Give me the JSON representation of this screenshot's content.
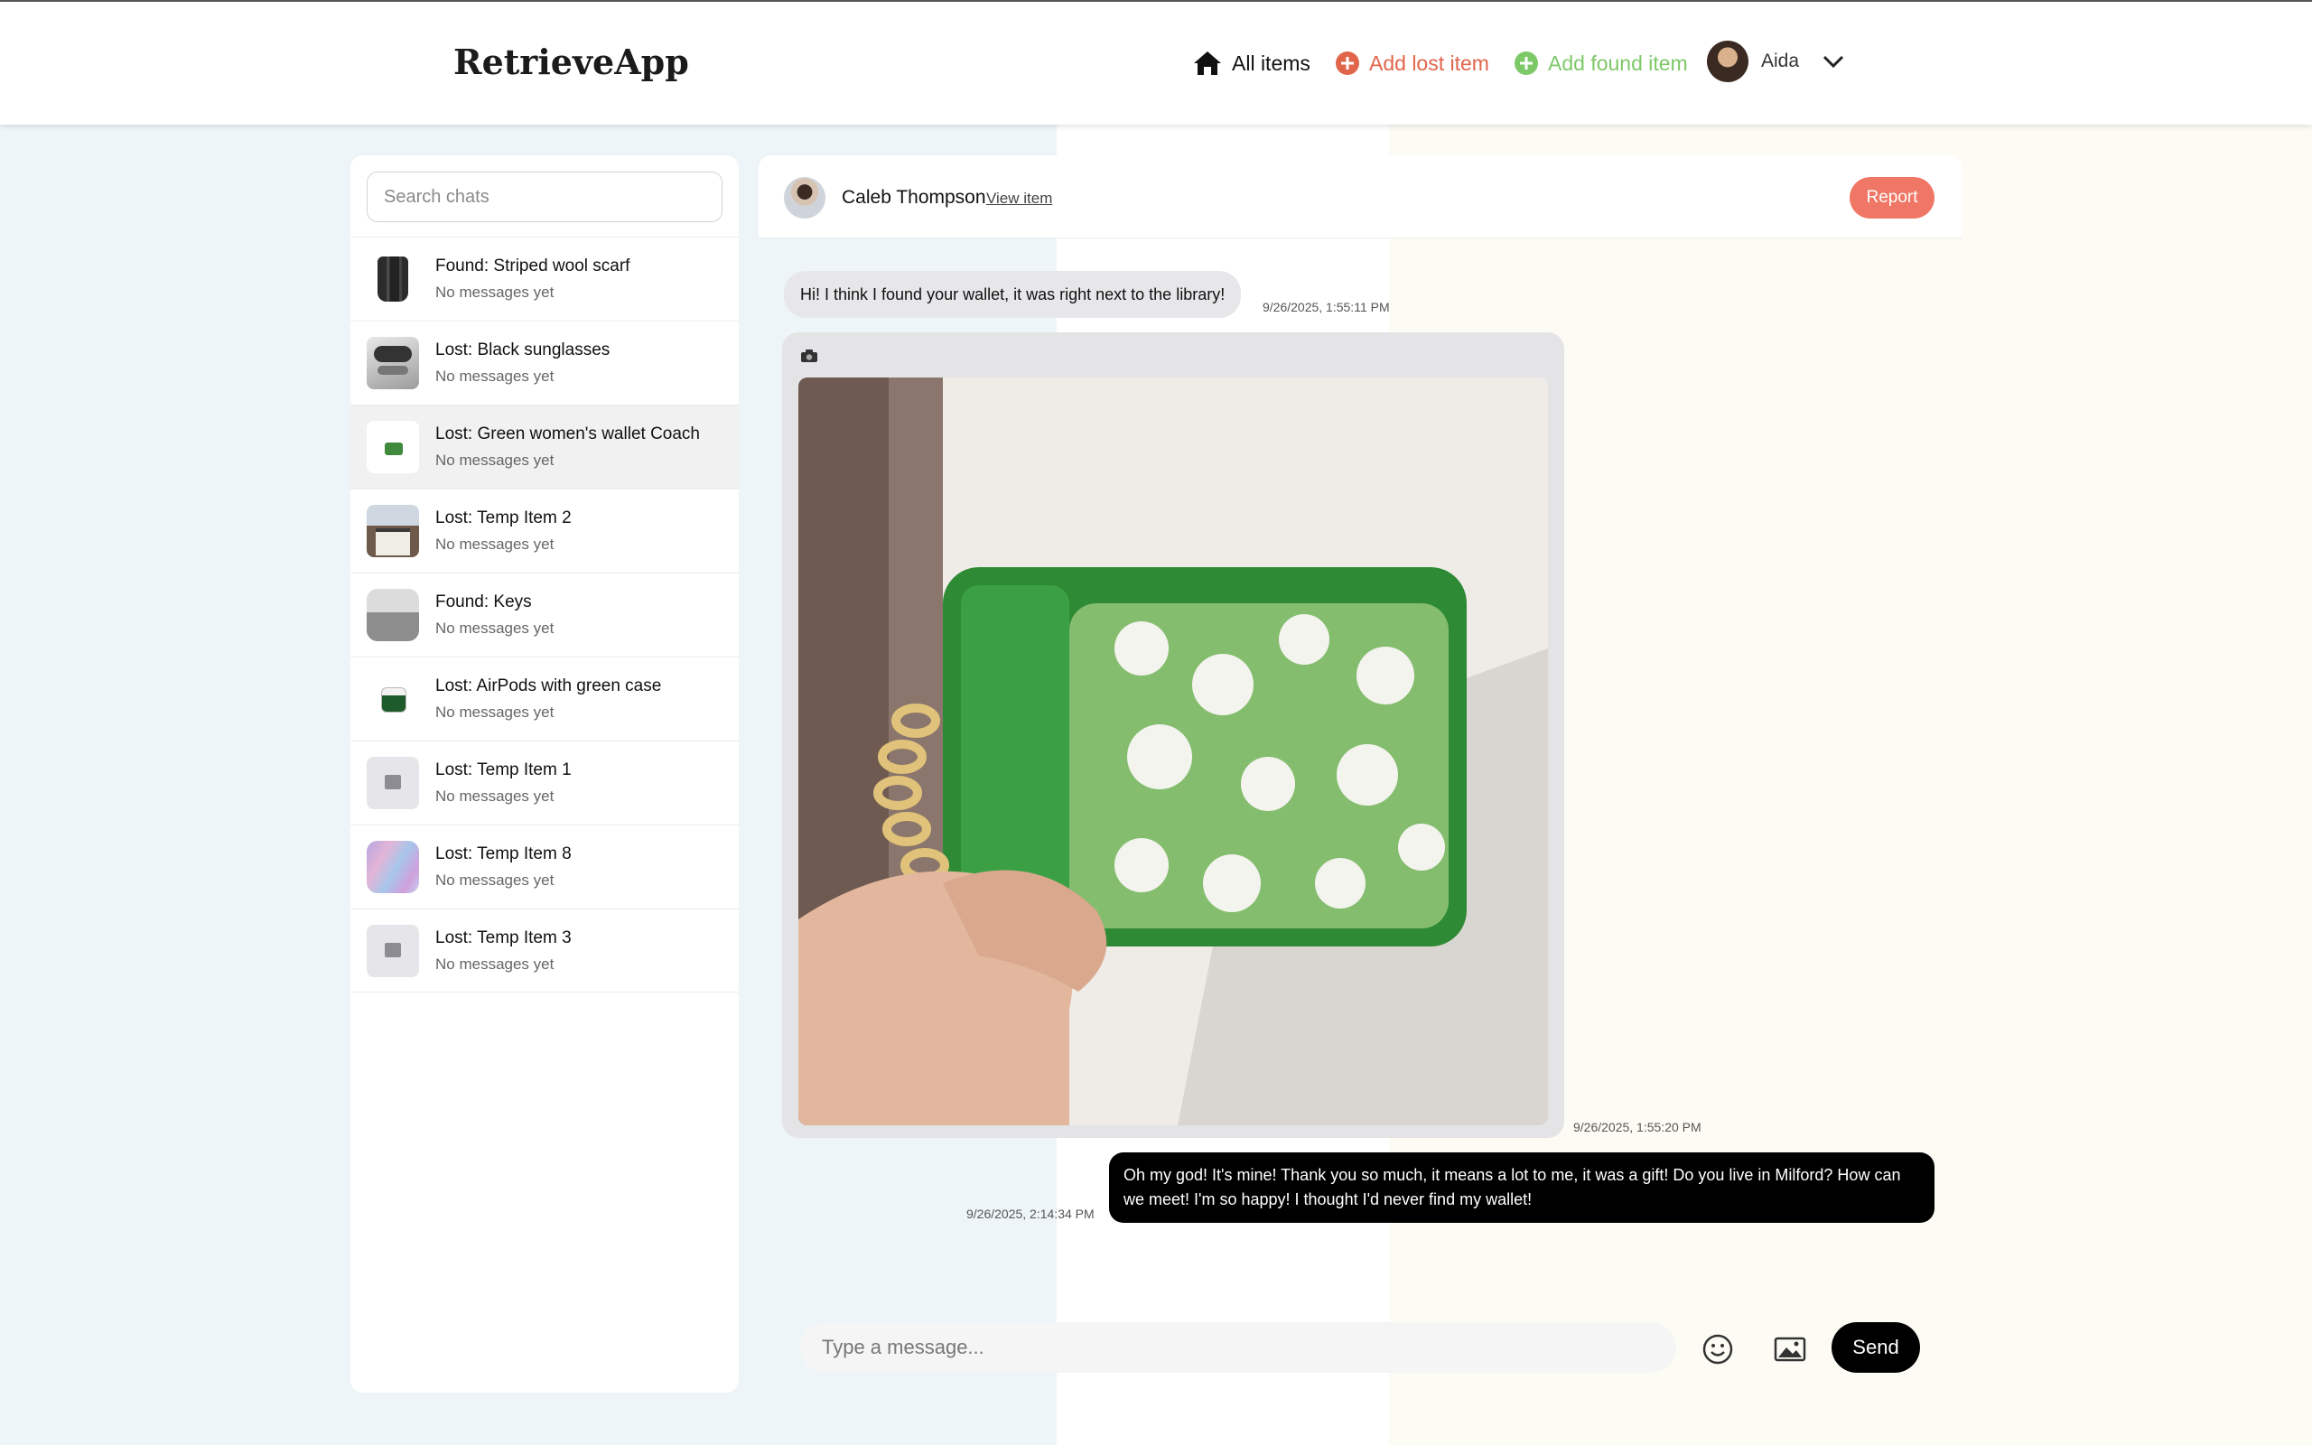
{
  "app": {
    "brand": "RetrieveApp"
  },
  "nav": {
    "all_items": "All items",
    "add_lost": "Add lost item",
    "add_found": "Add found item",
    "user_name": "Aida"
  },
  "sidebar": {
    "search_placeholder": "Search chats",
    "items": [
      {
        "title": "Found: Striped wool scarf",
        "subtitle": "No messages yet",
        "thumb": "scarf"
      },
      {
        "title": "Lost: Black sunglasses",
        "subtitle": "No messages yet",
        "thumb": "sunglasses"
      },
      {
        "title": "Lost: Green women's wallet Coach",
        "subtitle": "No messages yet",
        "thumb": "wallet",
        "active": true
      },
      {
        "title": "Lost: Temp Item 2",
        "subtitle": "No messages yet",
        "thumb": "house"
      },
      {
        "title": "Found: Keys",
        "subtitle": "No messages yet",
        "thumb": "keys"
      },
      {
        "title": "Lost: AirPods with green case",
        "subtitle": "No messages yet",
        "thumb": "airpods"
      },
      {
        "title": "Lost: Temp Item 1",
        "subtitle": "No messages yet",
        "thumb": "placeholder"
      },
      {
        "title": "Lost: Temp Item 8",
        "subtitle": "No messages yet",
        "thumb": "marble"
      },
      {
        "title": "Lost: Temp Item 3",
        "subtitle": "No messages yet",
        "thumb": "placeholder"
      }
    ]
  },
  "chat": {
    "contact_name": "Caleb Thompson",
    "view_item": "View item",
    "report": "Report",
    "messages": [
      {
        "text": "Hi! I think I found your wallet, it was right next to the library!",
        "time": "9/26/2025, 1:55:11 PM"
      },
      {
        "image": "green-wallet-photo",
        "time": "9/26/2025, 1:55:20 PM"
      },
      {
        "text": "Oh my god! It's mine! Thank you so much, it means a lot to me, it was a gift! Do you live in Milford? How can we meet! I'm so happy! I thought I'd never find my wallet!",
        "time": "9/26/2025, 2:14:34 PM"
      }
    ],
    "composer_placeholder": "Type a message...",
    "send": "Send"
  },
  "colors": {
    "lost_accent": "#e0654a",
    "found_accent": "#7dc867",
    "report_button": "#f07766"
  }
}
